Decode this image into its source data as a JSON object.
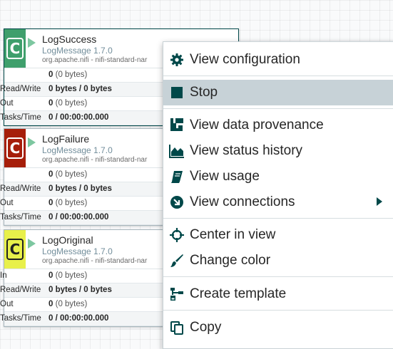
{
  "processors": [
    {
      "name": "LogSuccess",
      "type": "LogMessage 1.7.0",
      "bundle": "org.apache.nifi - nifi-standard-nar",
      "icon_color": "#3f9f6c",
      "rows": [
        {
          "label": "",
          "value_bold": "0",
          "value_sub": "(0 bytes)"
        },
        {
          "label": "Read/Write",
          "value_bold": "0 bytes / 0 bytes",
          "value_sub": ""
        },
        {
          "label": "Out",
          "value_bold": "0",
          "value_sub": "(0 bytes)"
        },
        {
          "label": "Tasks/Time",
          "value_bold": "0 / 00:00:00.000",
          "value_sub": ""
        }
      ]
    },
    {
      "name": "LogFailure",
      "type": "LogMessage 1.7.0",
      "bundle": "org.apache.nifi - nifi-standard-nar",
      "icon_color": "#a61e0a",
      "rows": [
        {
          "label": "",
          "value_bold": "0",
          "value_sub": "(0 bytes)"
        },
        {
          "label": "Read/Write",
          "value_bold": "0 bytes / 0 bytes",
          "value_sub": ""
        },
        {
          "label": "Out",
          "value_bold": "0",
          "value_sub": "(0 bytes)"
        },
        {
          "label": "Tasks/Time",
          "value_bold": "0 / 00:00:00.000",
          "value_sub": ""
        }
      ]
    },
    {
      "name": "LogOriginal",
      "type": "LogMessage 1.7.0",
      "bundle": "org.apache.nifi - nifi-standard-nar",
      "icon_color": "#e8f04a",
      "rows": [
        {
          "label": "In",
          "value_bold": "0",
          "value_sub": "(0 bytes)"
        },
        {
          "label": "Read/Write",
          "value_bold": "0 bytes / 0 bytes",
          "value_sub": ""
        },
        {
          "label": "Out",
          "value_bold": "0",
          "value_sub": "(0 bytes)"
        },
        {
          "label": "Tasks/Time",
          "value_bold": "0 / 00:00:00.000",
          "value_sub": ""
        }
      ]
    }
  ],
  "context_menu": {
    "items": [
      {
        "label": "View configuration",
        "icon": "gear-icon"
      },
      {
        "label": "Stop",
        "icon": "stop-icon"
      },
      {
        "label": "View data provenance",
        "icon": "provenance-icon"
      },
      {
        "label": "View status history",
        "icon": "area-chart-icon"
      },
      {
        "label": "View usage",
        "icon": "book-icon"
      },
      {
        "label": "View connections",
        "icon": "connections-icon"
      },
      {
        "label": "Center in view",
        "icon": "crosshairs-icon"
      },
      {
        "label": "Change color",
        "icon": "paintbrush-icon"
      },
      {
        "label": "Create template",
        "icon": "template-icon"
      },
      {
        "label": "Copy",
        "icon": "copy-icon"
      }
    ],
    "highlighted_item": "Stop"
  },
  "colors": {
    "accent": "#004849",
    "highlight": "#c7d2d7",
    "run_icon": "#7dc7a0"
  }
}
